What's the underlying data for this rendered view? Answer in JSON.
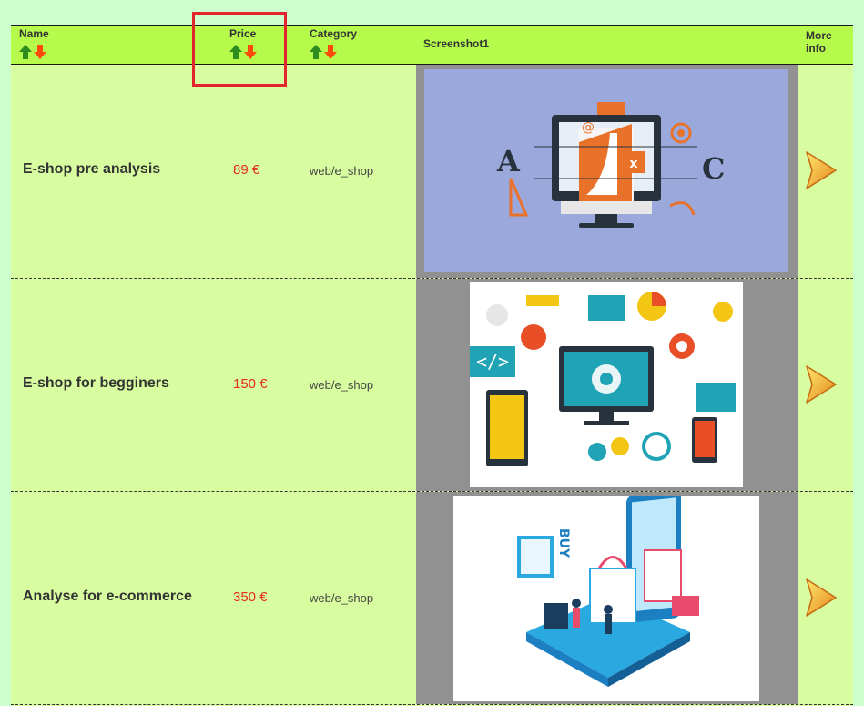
{
  "header": {
    "name_label": "Name",
    "price_label": "Price",
    "category_label": "Category",
    "screenshot_label": "Screenshot1",
    "more_label_line1": "More",
    "more_label_line2": "info"
  },
  "rows": [
    {
      "name": "E-shop pre analysis",
      "price": "89 €",
      "category": "web/e_shop",
      "shot_letters": [
        "A",
        "C"
      ]
    },
    {
      "name": "E-shop for begginers",
      "price": "150 €",
      "category": "web/e_shop"
    },
    {
      "name": "Analyse for e-commerce",
      "price": "350 €",
      "category": "web/e_shop",
      "shot_word": "BUY"
    }
  ],
  "colors": {
    "page_bg": "#ccffcc",
    "table_bg": "#d8fda0",
    "header_bg": "#b6fb4c",
    "price_text": "#e32b1c",
    "highlight_border": "#e3262b",
    "screenshot_cell_bg": "#919191",
    "sort_up": "#2e8b1e",
    "sort_down": "#ff4a0a"
  },
  "icons": [
    "sort-ascending-icon",
    "sort-descending-icon",
    "more-info-arrow-icon"
  ]
}
